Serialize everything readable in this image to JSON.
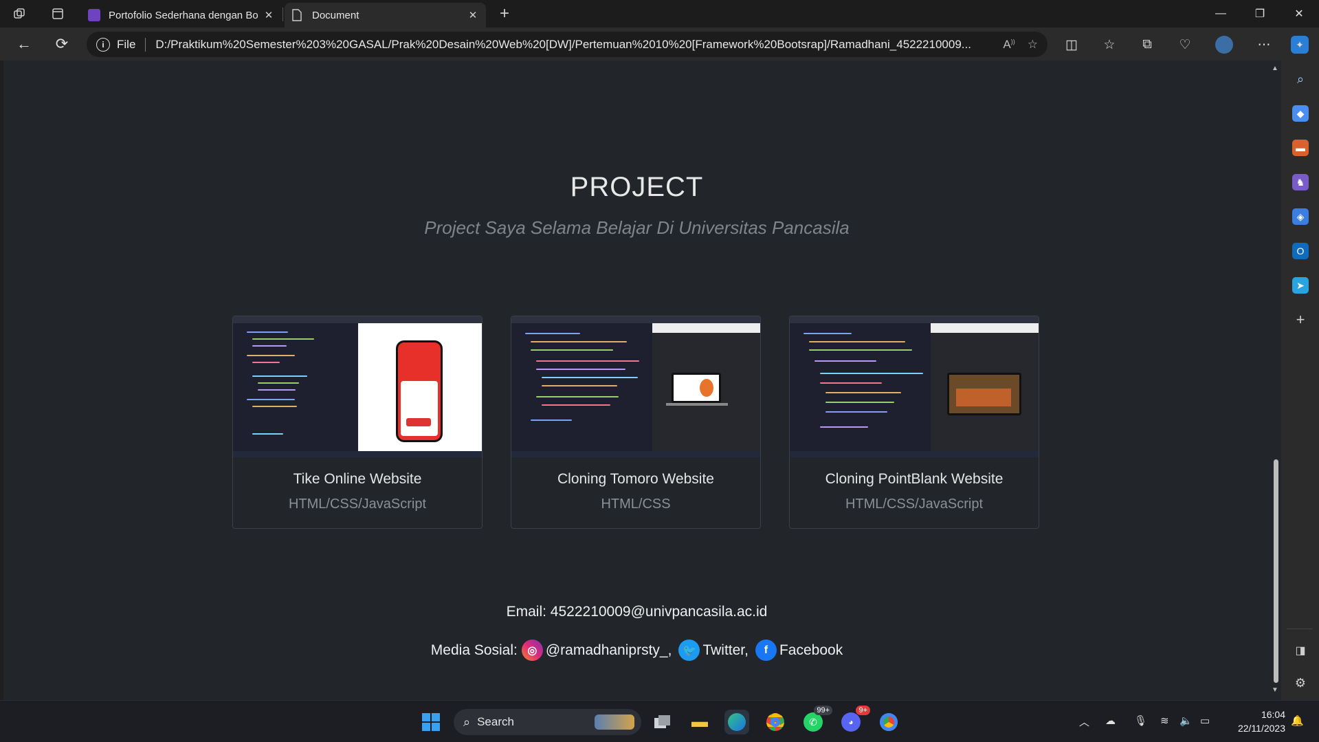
{
  "browser": {
    "tabs": [
      {
        "title": "Portofolio Sederhana dengan Bo",
        "active": false
      },
      {
        "title": "Document",
        "active": true
      }
    ],
    "address": {
      "scheme_label": "File",
      "url": "D:/Praktikum%20Semester%203%20GASAL/Prak%20Desain%20Web%20[DW]/Pertemuan%2010%20[Framework%20Bootsrap]/Ramadhani_4522210009..."
    }
  },
  "page": {
    "section_title": "PROJECT",
    "section_subtitle": "Project Saya Selama Belajar Di Universitas Pancasila",
    "projects": [
      {
        "title": "Tike Online Website",
        "tech": "HTML/CSS/JavaScript"
      },
      {
        "title": "Cloning Tomoro Website",
        "tech": "HTML/CSS"
      },
      {
        "title": "Cloning PointBlank Website",
        "tech": "HTML/CSS/JavaScript"
      }
    ],
    "contact": {
      "email_text": "Email: 4522210009@univpancasila.ac.id",
      "social_label": "Media Sosial:",
      "instagram": "@ramadhaniprsty_,",
      "twitter": "Twitter,",
      "facebook": "Facebook"
    }
  },
  "taskbar": {
    "search_label": "Search",
    "whatsapp_badge": "99+",
    "discord_badge": "9+",
    "time": "16:04",
    "date": "22/11/2023"
  },
  "colors": {
    "page_bg": "#222529",
    "instagram": "#e1306c",
    "twitter": "#1d9bf0",
    "facebook": "#1877f2",
    "tiket_red": "#e8302a"
  }
}
